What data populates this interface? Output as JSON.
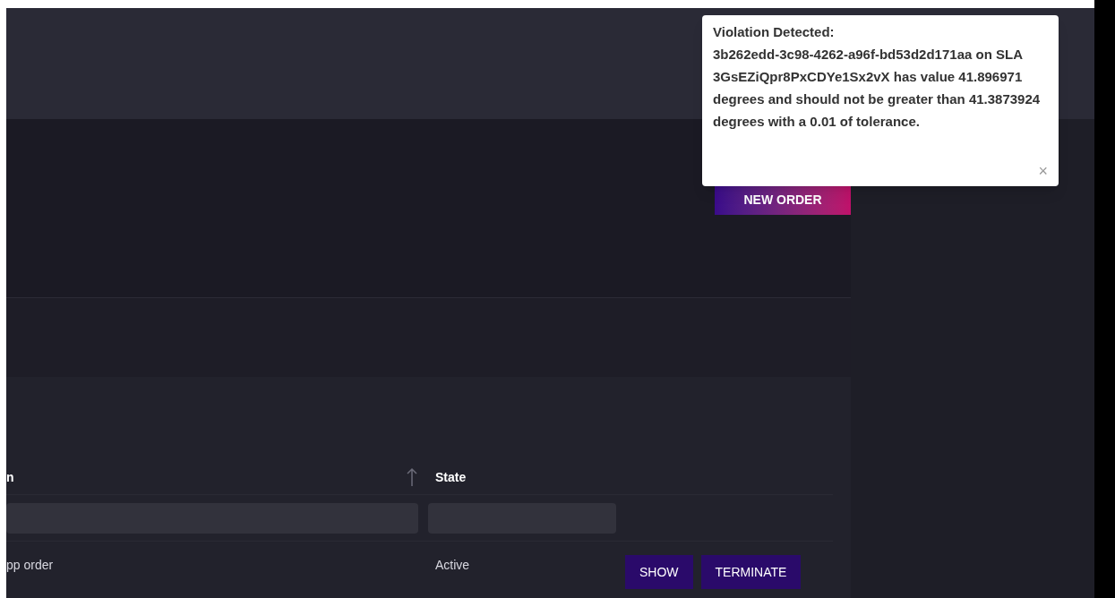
{
  "toast": {
    "title": "Violation Detected:",
    "message": "3b262edd-3c98-4262-a96f-bd53d2d171aa on SLA 3GsEZiQpr8PxCDYe1Sx2vX has value 41.896971 degrees and should not be greater than 41.3873924 degrees with a 0.01 of tolerance.",
    "close": "×"
  },
  "new_order_button": "NEW ORDER",
  "table": {
    "columns": [
      {
        "label": "n",
        "sorted": true
      },
      {
        "label": "State",
        "sorted": false
      }
    ],
    "rows": [
      {
        "cells": [
          "pp order",
          "Active"
        ],
        "actions": [
          "SHOW",
          "TERMINATE"
        ]
      }
    ]
  }
}
